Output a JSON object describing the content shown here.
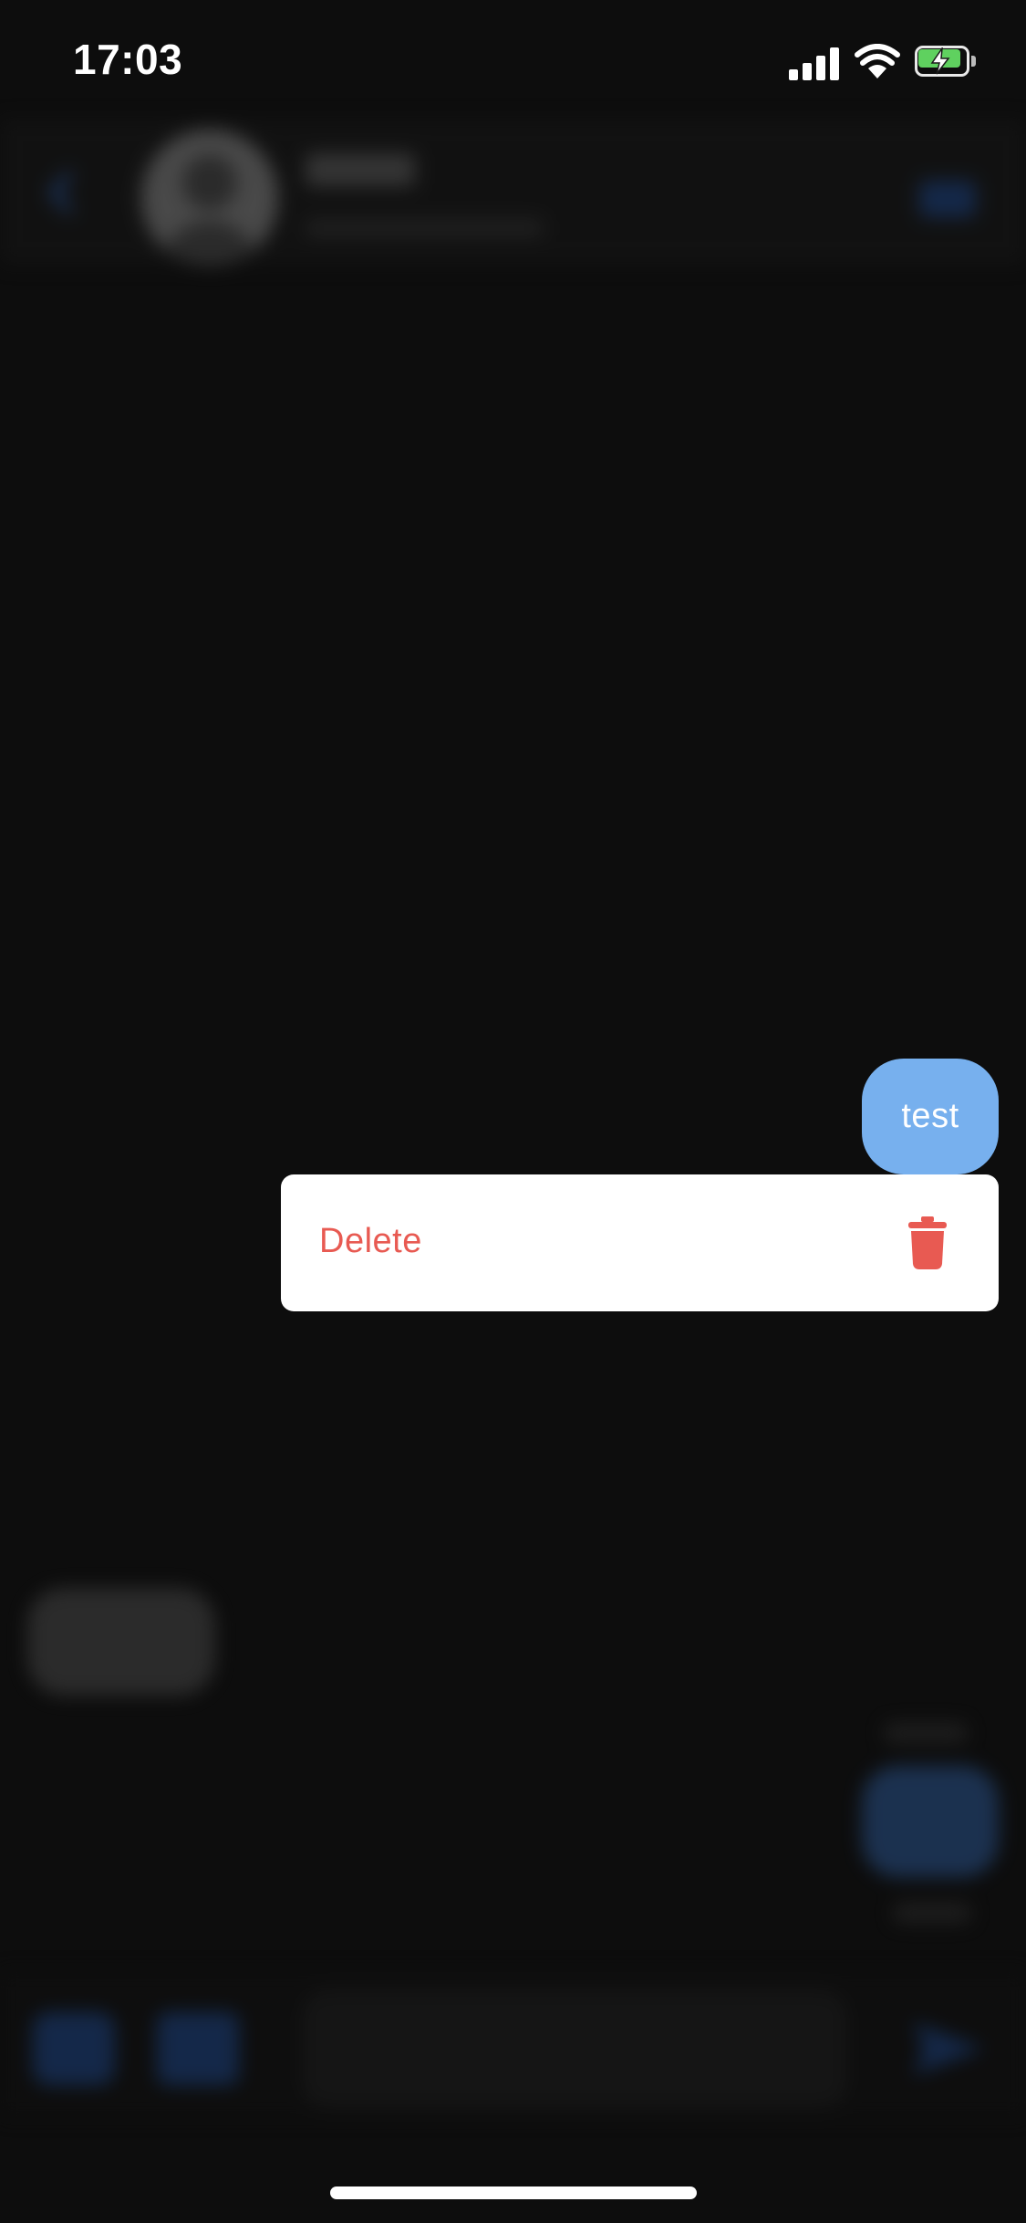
{
  "status_bar": {
    "time": "17:03"
  },
  "message": {
    "text": "test"
  },
  "context_menu": {
    "items": [
      {
        "label": "Delete",
        "icon": "trash-icon",
        "color": "#e85a52"
      }
    ]
  },
  "colors": {
    "background": "#0d0d0d",
    "bubble": "#77b0ee",
    "menu_background": "#ffffff",
    "accent": "#1b3f7a"
  }
}
